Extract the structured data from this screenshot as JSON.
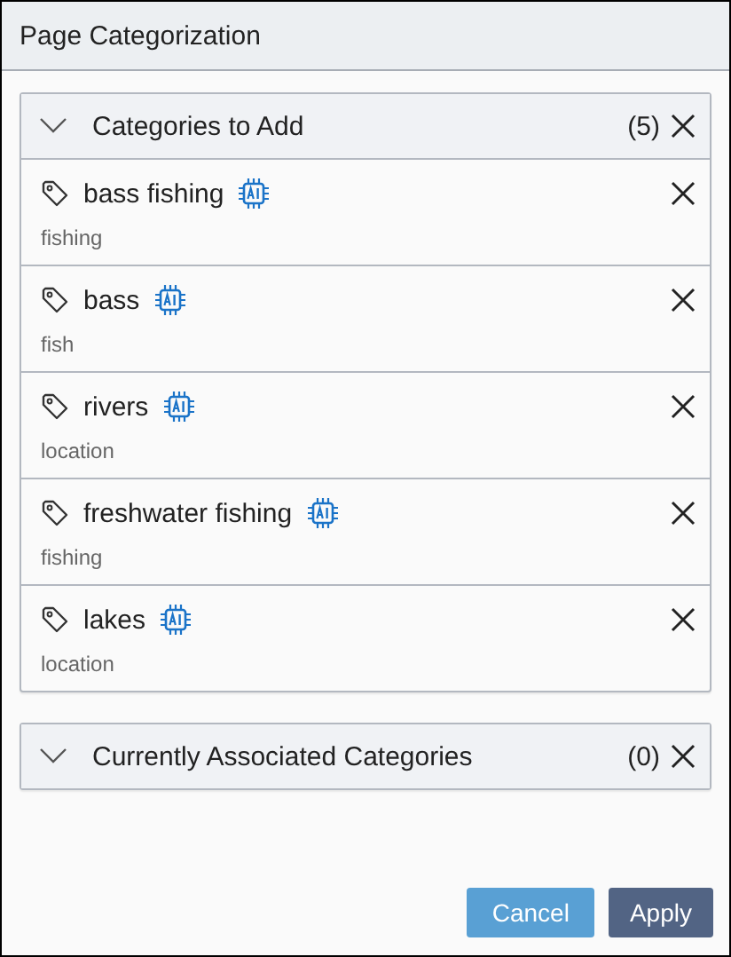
{
  "window": {
    "title": "Page Categorization"
  },
  "sections": [
    {
      "title": "Categories to Add",
      "count": "(5)",
      "expanded": true,
      "items": [
        {
          "name": "bass fishing",
          "type": "fishing",
          "ai": true
        },
        {
          "name": "bass",
          "type": "fish",
          "ai": true
        },
        {
          "name": "rivers",
          "type": "location",
          "ai": true
        },
        {
          "name": "freshwater fishing",
          "type": "fishing",
          "ai": true
        },
        {
          "name": "lakes",
          "type": "location",
          "ai": true
        }
      ]
    },
    {
      "title": "Currently Associated Categories",
      "count": "(0)",
      "expanded": false
    }
  ],
  "buttons": [
    {
      "label": "Cancel",
      "kind": "secondary"
    },
    {
      "label": "Apply",
      "kind": "primary"
    }
  ]
}
